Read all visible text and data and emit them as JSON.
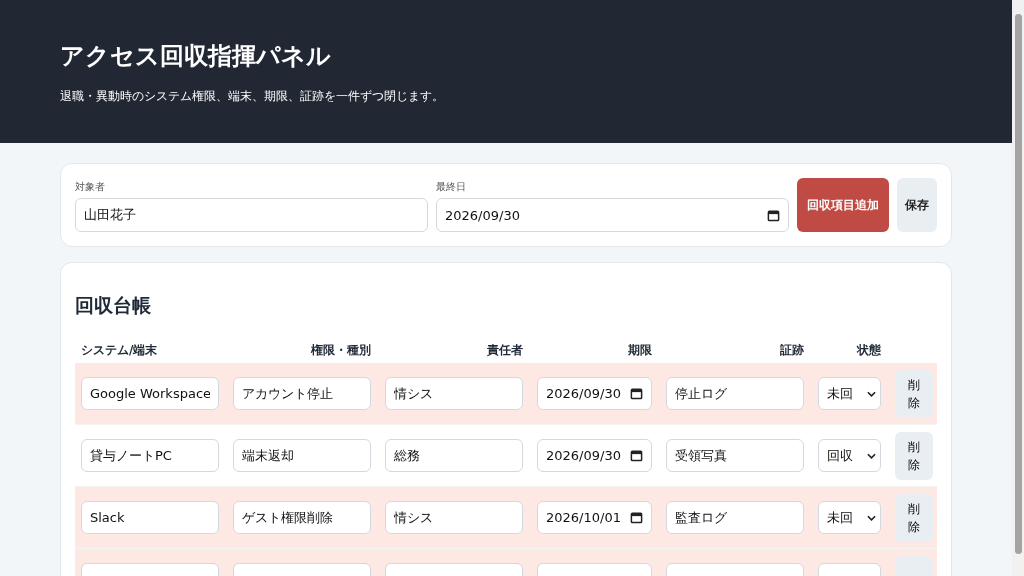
{
  "header": {
    "title": "アクセス回収指揮パネル",
    "subtitle": "退職・異動時のシステム権限、端末、期限、証跡を一件ずつ閉じます。"
  },
  "form": {
    "subject": {
      "label": "対象者",
      "value": "山田花子"
    },
    "last_day": {
      "label": "最終日",
      "value": "2026/09/30"
    },
    "add_button": "回収項目追加",
    "save_button": "保存"
  },
  "ledger": {
    "title": "回収台帳",
    "columns": [
      "システム/端末",
      "権限・種別",
      "責任者",
      "期限",
      "証跡",
      "状態"
    ],
    "rows": [
      {
        "system": "Google Workspace",
        "type": "アカウント停止",
        "owner": "情シス",
        "due": "2026/09/30",
        "evidence": "停止ログ",
        "status": "未回",
        "pending": true,
        "delete_label": "削除"
      },
      {
        "system": "貸与ノートPC",
        "type": "端末返却",
        "owner": "総務",
        "due": "2026/09/30",
        "evidence": "受領写真",
        "status": "回収",
        "pending": false,
        "delete_label": "削除"
      },
      {
        "system": "Slack",
        "type": "ゲスト権限削除",
        "owner": "情シス",
        "due": "2026/10/01",
        "evidence": "監査ログ",
        "status": "未回",
        "pending": true,
        "delete_label": "削除"
      },
      {
        "pending": true
      }
    ]
  }
}
